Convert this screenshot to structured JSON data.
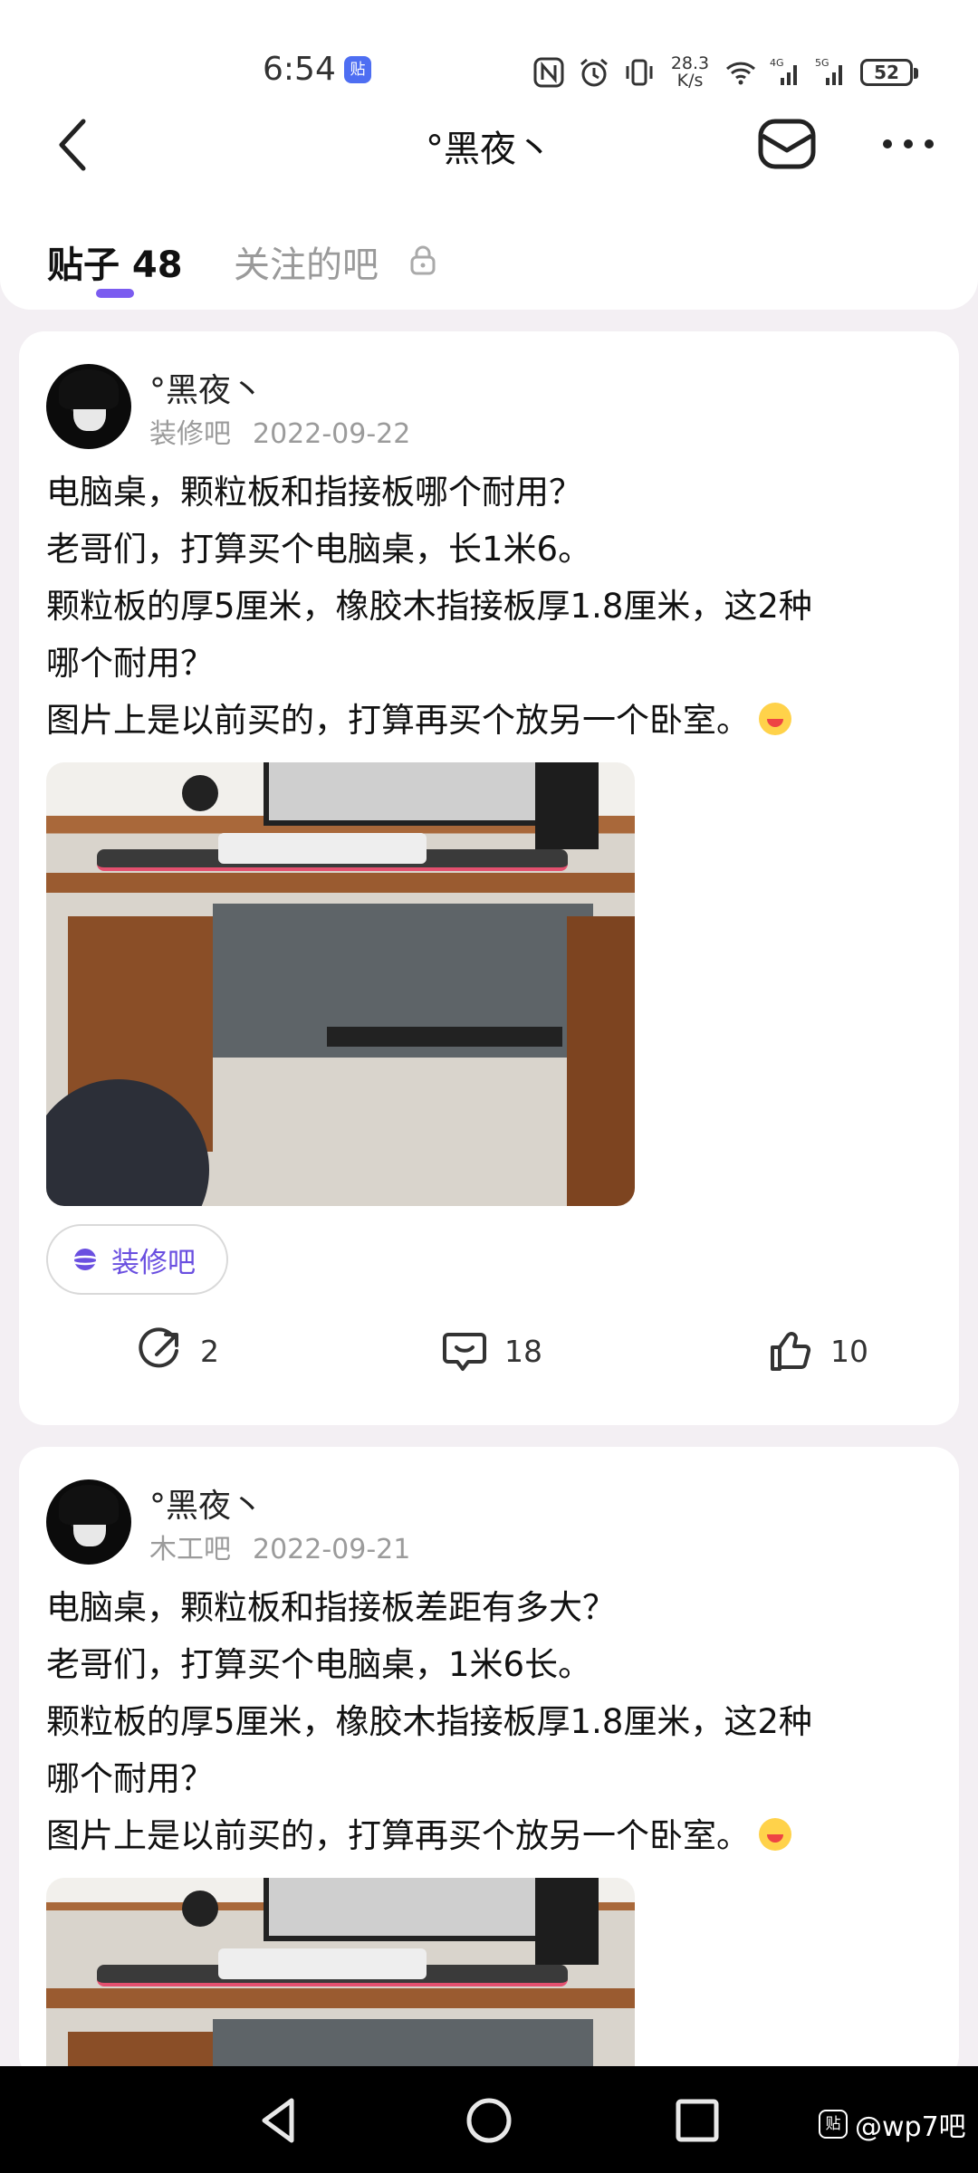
{
  "status_bar": {
    "time": "6:54",
    "app_badge": "贴",
    "net_speed_value": "28.3",
    "net_speed_unit": "K/s",
    "signal_1_label": "4G",
    "signal_2_label": "5G",
    "battery": "52",
    "icons": [
      "nfc-icon",
      "alarm-icon",
      "vibrate-icon",
      "wifi-icon",
      "signal-icon",
      "signal-icon",
      "battery-icon"
    ]
  },
  "header": {
    "title": "°黑夜丶",
    "icons": [
      "back-arrow-icon",
      "mail-icon",
      "more-icon"
    ]
  },
  "tabs": [
    {
      "label": "贴子 48",
      "active": true
    },
    {
      "label": "关注的吧",
      "active": false,
      "locked": true
    }
  ],
  "posts": [
    {
      "author": "°黑夜丶",
      "forum": "装修吧",
      "date": "2022-09-22",
      "lines": [
        "电脑桌，颗粒板和指接板哪个耐用？",
        "老哥们，打算买个电脑桌，长1米6。",
        "颗粒板的厚5厘米，橡胶木指接板厚1.8厘米，这2种",
        "哪个耐用？",
        "图片上是以前买的，打算再买个放另一个卧室。"
      ],
      "tag": "装修吧",
      "shares": "2",
      "comments": "18",
      "likes": "10"
    },
    {
      "author": "°黑夜丶",
      "forum": "木工吧",
      "date": "2022-09-21",
      "lines": [
        "电脑桌，颗粒板和指接板差距有多大？",
        "老哥们，打算买个电脑桌，1米6长。",
        "颗粒板的厚5厘米，橡胶木指接板厚1.8厘米，这2种",
        "哪个耐用？",
        "图片上是以前买的，打算再买个放另一个卧室。"
      ]
    }
  ],
  "watermark": {
    "logo": "贴",
    "text": "@wp7吧"
  },
  "colors": {
    "accent": "#7b5cf0",
    "background": "#f3eff3",
    "tag_text": "#6a4fe0"
  }
}
